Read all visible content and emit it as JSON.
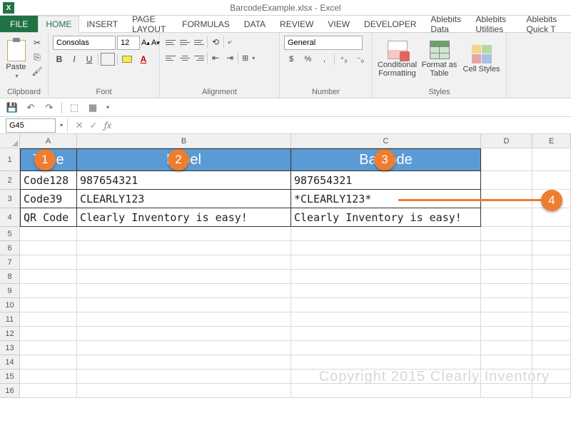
{
  "title": "BarcodeExample.xlsx - Excel",
  "tabs": {
    "file": "FILE",
    "list": [
      "HOME",
      "INSERT",
      "PAGE LAYOUT",
      "FORMULAS",
      "DATA",
      "REVIEW",
      "VIEW",
      "DEVELOPER",
      "Ablebits Data",
      "Ablebits Utilities",
      "Ablebits Quick T"
    ],
    "active": "HOME"
  },
  "ribbon": {
    "clipboard": {
      "label": "Clipboard",
      "paste": "Paste"
    },
    "font": {
      "label": "Font",
      "name": "Consolas",
      "size": "12",
      "bold": "B",
      "italic": "I",
      "underline": "U"
    },
    "alignment": {
      "label": "Alignment",
      "wrap": "",
      "merge": ""
    },
    "number": {
      "label": "Number",
      "format": "General",
      "currency": "$",
      "percent": "%",
      "comma": ","
    },
    "styles": {
      "label": "Styles",
      "cond": "Conditional Formatting",
      "table": "Format as Table",
      "cell": "Cell Styles"
    }
  },
  "name_box": "G45",
  "columns": [
    "A",
    "B",
    "C",
    "D",
    "E"
  ],
  "header_row": {
    "A": "Type",
    "B": "Label",
    "C": "Barcode"
  },
  "data_rows": [
    {
      "A": "Code128",
      "B": "987654321",
      "C": "987654321"
    },
    {
      "A": "Code39",
      "B": "CLEARLY123",
      "C": "*CLEARLY123*"
    },
    {
      "A": "QR Code",
      "B": "Clearly Inventory is easy!",
      "C": "Clearly Inventory is easy!"
    }
  ],
  "row_nums": [
    "1",
    "2",
    "3",
    "4",
    "5",
    "6",
    "7",
    "8",
    "9",
    "10",
    "11",
    "12",
    "13",
    "14",
    "15",
    "16"
  ],
  "callouts": {
    "c1": "1",
    "c2": "2",
    "c3": "3",
    "c4": "4"
  },
  "watermark": "Copyright 2015 Clearly Inventory"
}
